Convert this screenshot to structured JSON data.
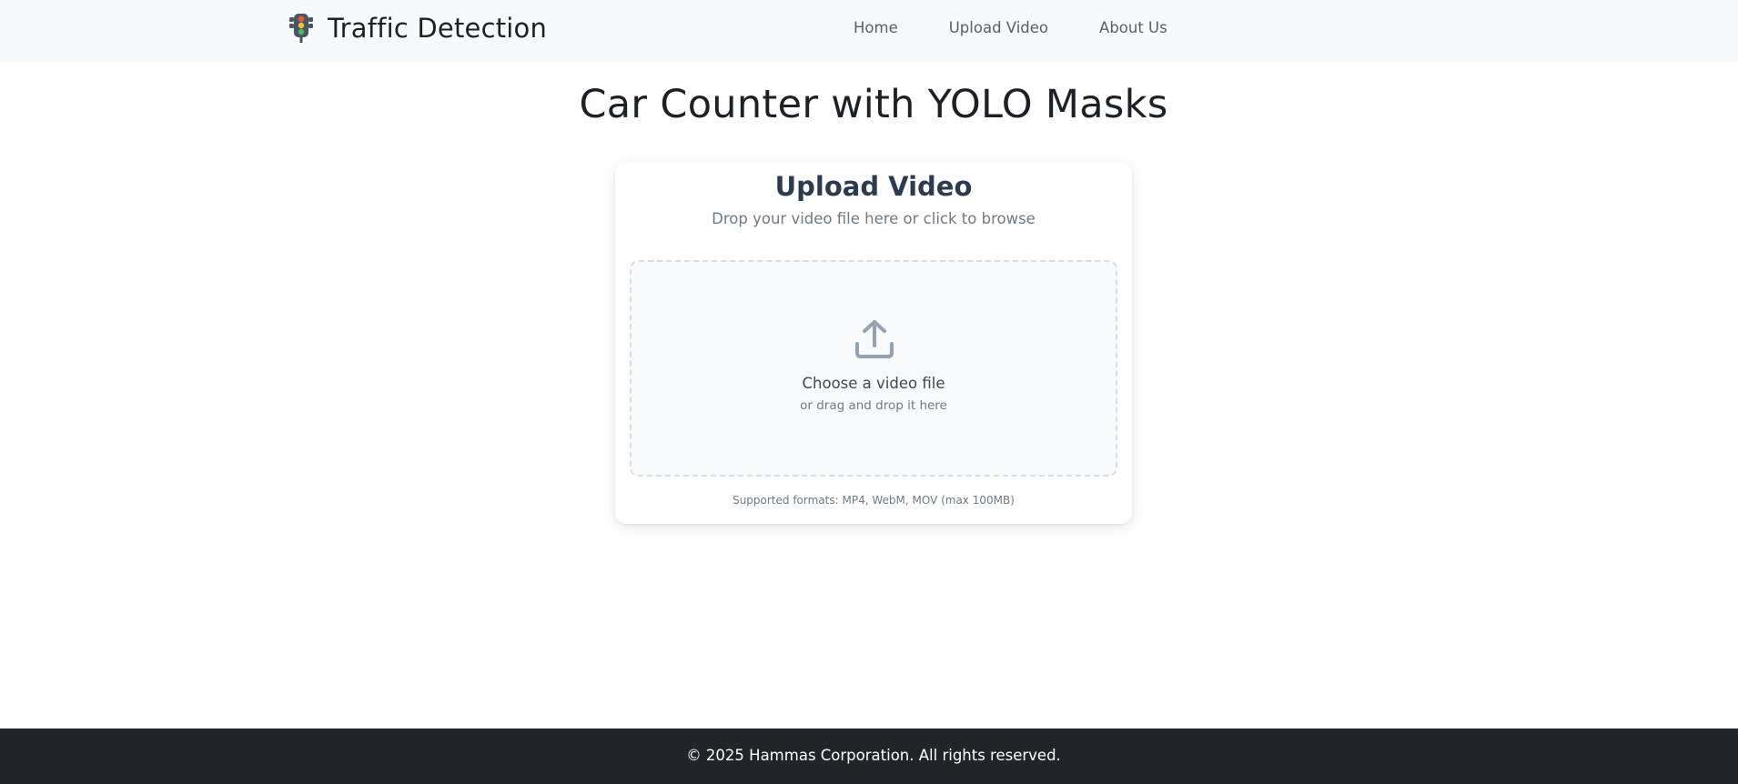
{
  "navbar": {
    "brand_text": "Traffic Detection",
    "brand_icon": "traffic-light-icon",
    "links": [
      {
        "label": "Home"
      },
      {
        "label": "Upload Video"
      },
      {
        "label": "About Us"
      }
    ]
  },
  "main": {
    "title": "Car Counter with YOLO Masks"
  },
  "upload_card": {
    "title": "Upload Video",
    "subtitle": "Drop your video file here or click to browse",
    "dropzone": {
      "icon": "upload-icon",
      "title": "Choose a video file",
      "subtitle": "or drag and drop it here"
    },
    "formats_note": "Supported formats: MP4, WebM, MOV (max 100MB)"
  },
  "footer": {
    "text": "© 2025 Hammas Corporation. All rights reserved."
  },
  "colors": {
    "navbar_bg": "#f8f9fa",
    "footer_bg": "#212529",
    "dropzone_bg": "#f8fafc",
    "icon_gray": "#94a3b1"
  }
}
